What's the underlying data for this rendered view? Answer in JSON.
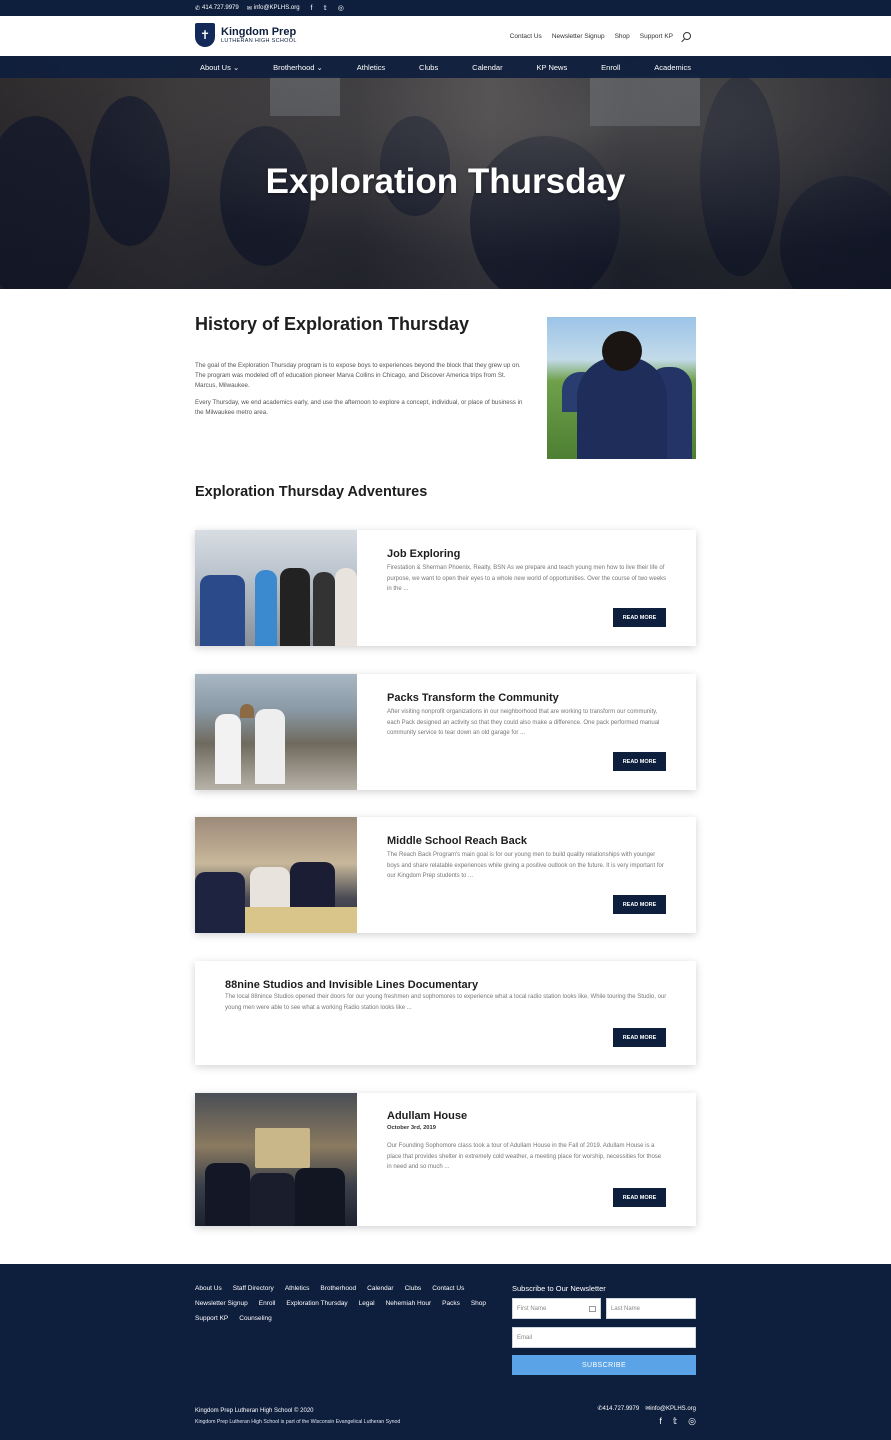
{
  "topbar": {
    "phone": "414.727.9979",
    "email": "info@KPLHS.org",
    "social": [
      "f",
      "𝕥",
      "◎"
    ]
  },
  "header": {
    "logo_line1": "Kingdom Prep",
    "logo_line2": "LUTHERAN HIGH SCHOOL",
    "links": [
      "Contact Us",
      "Newsletter Signup",
      "Shop",
      "Support KP"
    ]
  },
  "nav": {
    "items": [
      "About Us",
      "Brotherhood",
      "Athletics",
      "Clubs",
      "Calendar",
      "KP News",
      "Enroll",
      "Academics"
    ],
    "dropdown_indicator": "⌄"
  },
  "hero": {
    "title": "Exploration Thursday"
  },
  "history": {
    "title": "History of Exploration Thursday",
    "p1": "The goal of the Exploration Thursday program is to expose boys to experiences beyond the block that they grew up on. The program was modeled off of education pioneer Marva Collins in Chicago, and Discover America trips from St. Marcus, Milwaukee.",
    "p2": "Every Thursday, we end academics early, and use the afternoon to explore a concept, individual, or place of business in the Milwaukee metro area."
  },
  "adventures": {
    "title": "Exploration Thursday Adventures",
    "cards": [
      {
        "title": "Job Exploring",
        "date": "",
        "excerpt": "Firestation & Sherman Phoenix, Realty, BSN As we prepare and teach young men how to live their life of purpose, we want to open their eyes to a whole new world of opportunities. Over the course of two weeks in the ...",
        "button": "READ MORE"
      },
      {
        "title": "Packs Transform the Community",
        "date": "",
        "excerpt": "After visiting nonprofit organizations in our neighborhood that are working to transform our community, each Pack designed an activity so that they could also make a difference. One pack performed manual community service to tear down an old garage for ...",
        "button": "READ MORE"
      },
      {
        "title": "Middle School Reach Back",
        "date": "",
        "excerpt": "The Reach Back Program's main goal is for our young men to build quality relationships with younger boys and share relatable experiences while giving a positive outlook on the future. It is very important for our Kingdom Prep students to ...",
        "button": "READ MORE"
      },
      {
        "title": "88nine Studios and Invisible Lines Documentary",
        "date": "",
        "excerpt": "The local 88nince Studios opened their doors for our young freshmen and sophomores to experience what a local radio station looks like. While touring the Studio, our young men were able to see what a working Radio station looks like ...",
        "button": "READ MORE"
      },
      {
        "title": "Adullam House",
        "date": "October 3rd, 2019",
        "excerpt": "Our Founding Sophomore class took a tour of Adullam House in the Fall of 2019. Adullam House is a place that provides shelter in extremely cold weather, a meeting place for worship, necessities for those in need and so much ...",
        "button": "READ MORE"
      }
    ]
  },
  "footer": {
    "links": [
      "About Us",
      "Staff Directory",
      "Athletics",
      "Brotherhood",
      "Calendar",
      "Clubs",
      "Contact Us",
      "Newsletter Signup",
      "Enroll",
      "Exploration Thursday",
      "Legal",
      "Nehemiah Hour",
      "Packs",
      "Shop",
      "Support KP",
      "Counseling"
    ],
    "newsletter_title": "Subscribe to Our Newsletter",
    "first_name_placeholder": "First Name",
    "last_name_placeholder": "Last Name",
    "email_placeholder": "Email",
    "subscribe_label": "SUBSCRIBE",
    "copyright": "Kingdom Prep Lutheran High School © 2020",
    "affiliation": "Kingdom Prep Lutheran High School is part of the Wisconsin Evangelical Lutheran Synod",
    "phone": "414.727.9979",
    "email": "info@KPLHS.org",
    "social": [
      "f",
      "𝕥",
      "◎"
    ]
  },
  "colors": {
    "navy": "#0e1e3d",
    "subscribe_blue": "#5aa3e6"
  }
}
